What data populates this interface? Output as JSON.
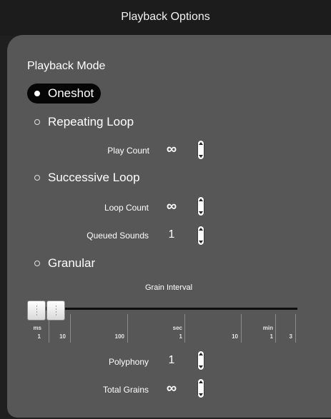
{
  "window": {
    "title": "Playback Options"
  },
  "section": {
    "title": "Playback Mode"
  },
  "modes": [
    {
      "label": "Oneshot",
      "selected": true
    },
    {
      "label": "Repeating Loop",
      "selected": false
    },
    {
      "label": "Successive Loop",
      "selected": false
    },
    {
      "label": "Granular",
      "selected": false
    }
  ],
  "repeating": {
    "play_count_label": "Play Count",
    "play_count_value": "∞"
  },
  "successive": {
    "loop_count_label": "Loop Count",
    "loop_count_value": "∞",
    "queued_label": "Queued Sounds",
    "queued_value": "1"
  },
  "granular": {
    "grain_interval_label": "Grain Interval",
    "scale_units": [
      "ms",
      "sec",
      "min"
    ],
    "scale_numbers": [
      "1",
      "10",
      "100",
      "1",
      "10",
      "1",
      "3"
    ],
    "polyphony_label": "Polyphony",
    "polyphony_value": "1",
    "total_grains_label": "Total Grains",
    "total_grains_value": "∞"
  },
  "icons": {
    "stepper": "up-down-stepper-icon",
    "radio": "radio-dot-icon"
  }
}
